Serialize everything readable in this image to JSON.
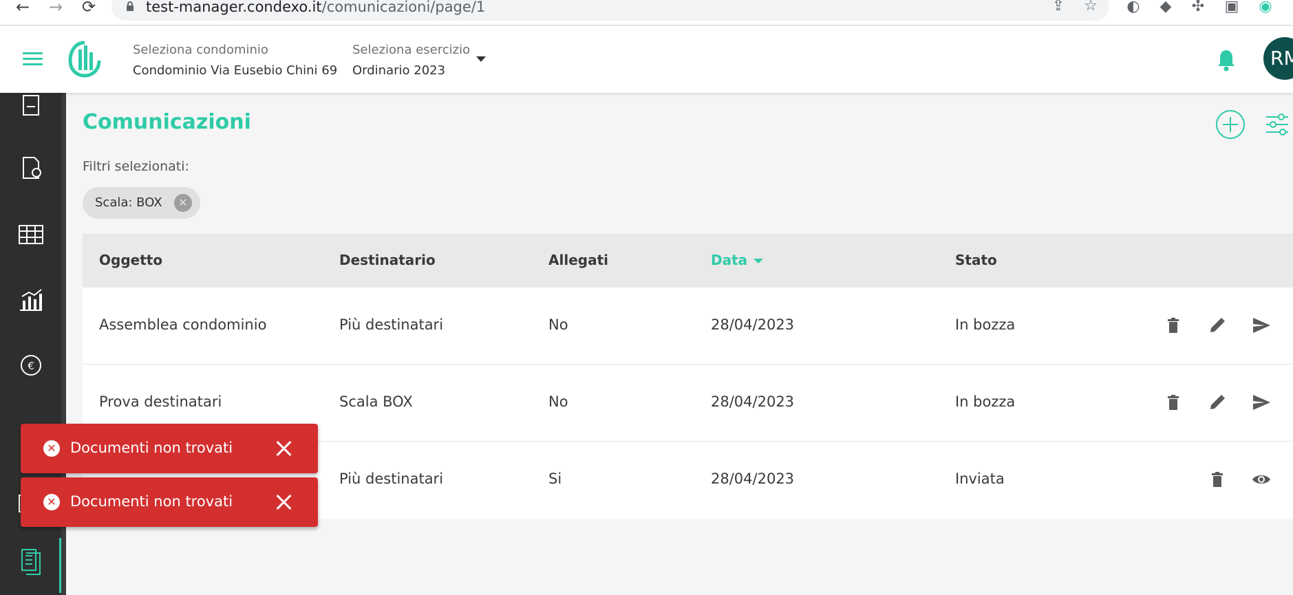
{
  "browser": {
    "url_host": "test-manager.condexo.it",
    "url_path": "/comunicazioni/page/1"
  },
  "header": {
    "condominio_label": "Seleziona condominio",
    "condominio_value": "Condominio Via Eusebio Chini 69",
    "esercizio_label": "Seleziona esercizio",
    "esercizio_value": "Ordinario 2023",
    "avatar_initials": "RM"
  },
  "page": {
    "title": "Comunicazioni",
    "filters_label": "Filtri selezionati:",
    "filter_chips": [
      "Scala: BOX"
    ]
  },
  "table": {
    "columns": [
      "Oggetto",
      "Destinatario",
      "Allegati",
      "Data",
      "Stato"
    ],
    "sorted_column": "Data",
    "rows": [
      {
        "oggetto": "Assemblea condominio",
        "destinatario": "Più destinatari",
        "allegati": "No",
        "data": "28/04/2023",
        "stato": "In bozza",
        "actions": [
          "delete-icon",
          "edit-icon",
          "send-icon"
        ]
      },
      {
        "oggetto": "Prova destinatari",
        "destinatario": "Scala BOX",
        "allegati": "No",
        "data": "28/04/2023",
        "stato": "In bozza",
        "actions": [
          "delete-icon",
          "edit-icon",
          "send-icon"
        ]
      },
      {
        "oggetto": "",
        "destinatario": "Più destinatari",
        "allegati": "Si",
        "data": "28/04/2023",
        "stato": "Inviata",
        "actions": [
          "delete-icon",
          "view-icon"
        ]
      }
    ]
  },
  "toasts": [
    {
      "message": "Documenti non trovati"
    },
    {
      "message": "Documenti non trovati"
    }
  ],
  "colors": {
    "accent": "#2fcba8",
    "sidebar": "#2e2e2e",
    "error": "#d32f2f",
    "avatar": "#0f4f4b"
  }
}
